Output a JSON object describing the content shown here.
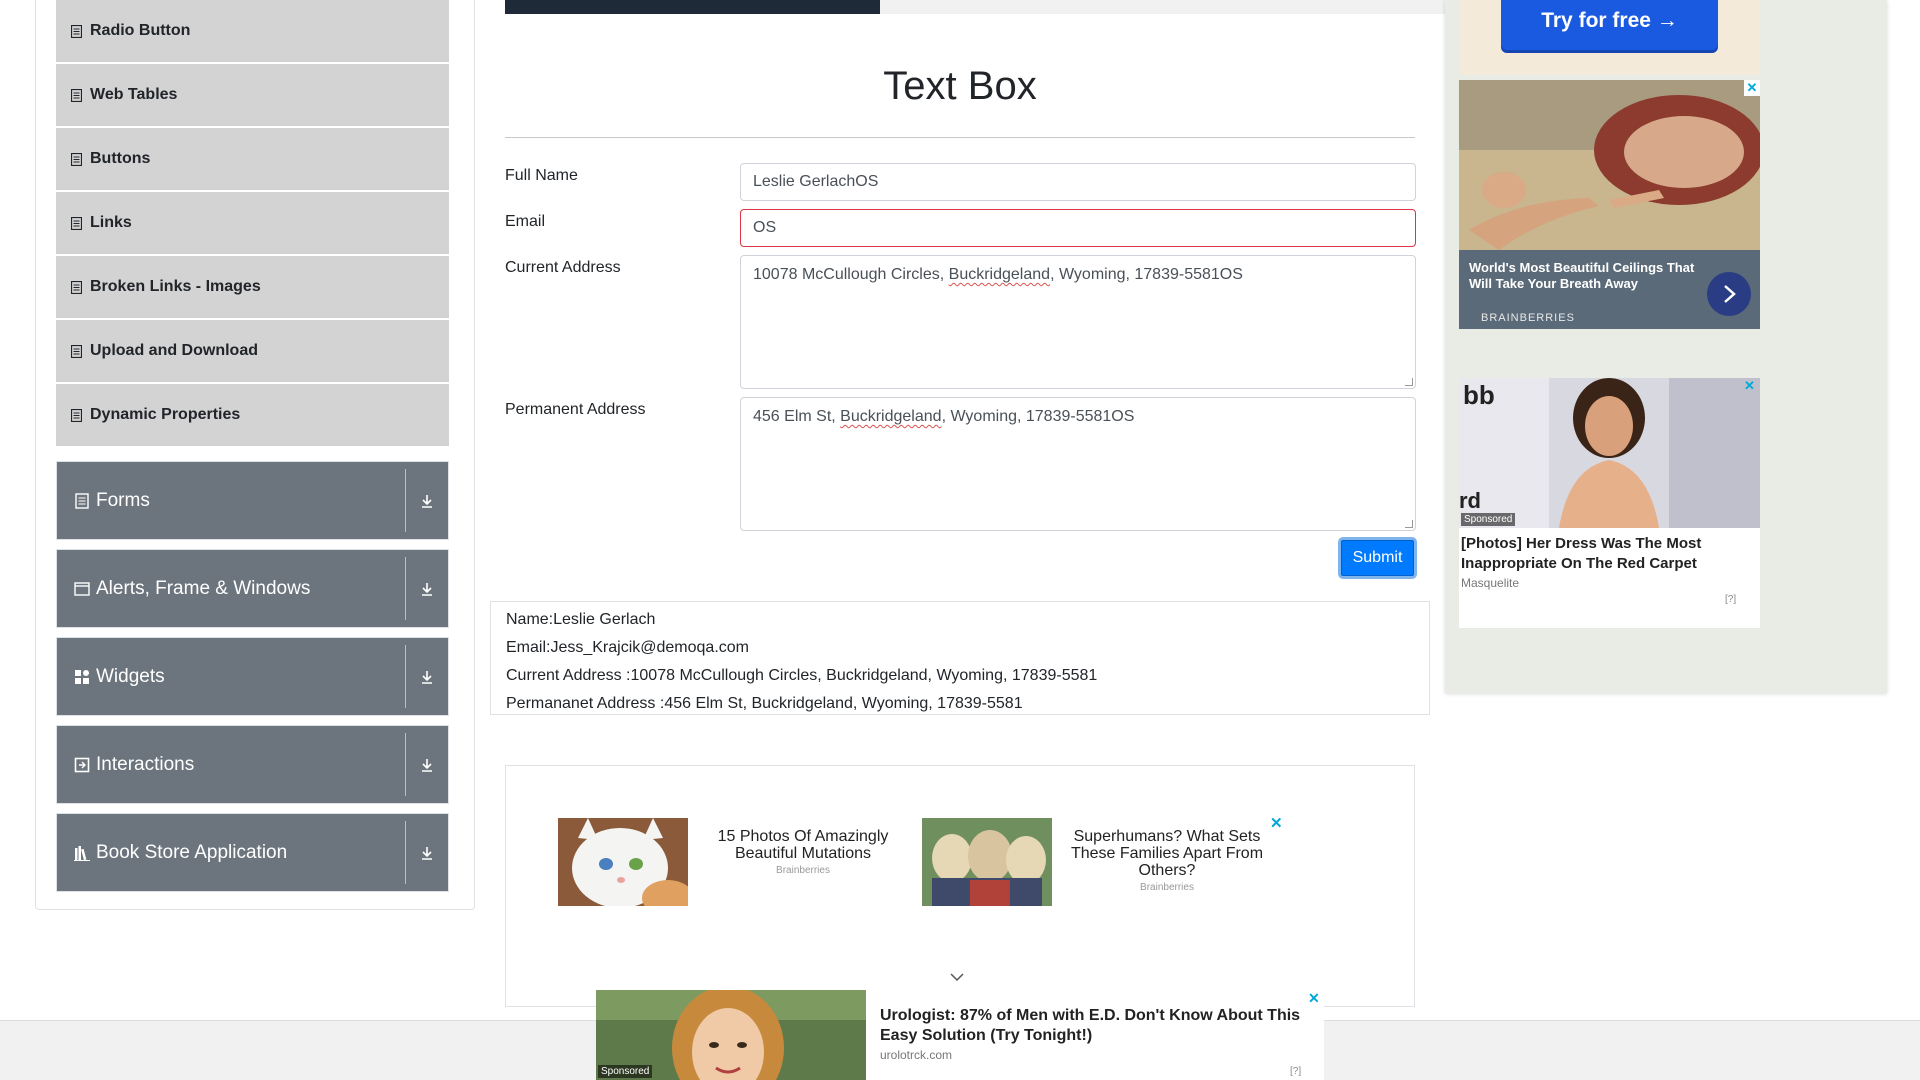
{
  "sidebar": {
    "menu_items": [
      {
        "label": "Radio Button"
      },
      {
        "label": "Web Tables"
      },
      {
        "label": "Buttons"
      },
      {
        "label": "Links"
      },
      {
        "label": "Broken Links - Images"
      },
      {
        "label": "Upload and Download"
      },
      {
        "label": "Dynamic Properties"
      }
    ],
    "groups": [
      {
        "label": "Forms",
        "icon": "form-icon"
      },
      {
        "label": "Alerts, Frame & Windows",
        "icon": "window-icon"
      },
      {
        "label": "Widgets",
        "icon": "widgets-icon"
      },
      {
        "label": "Interactions",
        "icon": "interactions-icon"
      },
      {
        "label": "Book Store Application",
        "icon": "bookstore-icon"
      }
    ]
  },
  "main": {
    "title": "Text Box",
    "form": {
      "full_name_label": "Full Name",
      "full_name_value": "Leslie GerlachOS",
      "email_label": "Email",
      "email_value": "OS",
      "current_address_label": "Current Address",
      "current_address_value": {
        "pre": "10078 McCullough Circles, ",
        "flagged": "Buckridgeland",
        "post": ", Wyoming, 17839-5581OS"
      },
      "permanent_address_label": "Permanent Address",
      "permanent_address_value": {
        "pre": "456 Elm St, ",
        "flagged": "Buckridgeland",
        "post": ", Wyoming, 17839-5581OS"
      },
      "submit_label": "Submit"
    },
    "output": {
      "name": "Name:Leslie Gerlach",
      "email": "Email:Jess_Krajcik@demoqa.com",
      "current_address": "Current Address :10078 McCullough Circles, Buckridgeland, Wyoming, 17839-5581",
      "permanent_address": "Permananet Address :456 Elm St, Buckridgeland, Wyoming, 17839-5581"
    }
  },
  "ads": {
    "try_button": "Try for free →",
    "ceiling": {
      "title": "World's Most Beautiful Ceilings That Will Take Your Breath Away",
      "source": "BRAINBERRIES"
    },
    "dress": {
      "title": "[Photos] Her Dress Was The Most Inappropriate On The Red Carpet",
      "source": "Masquelite",
      "sponsored": "Sponsored",
      "adchoice": "[?]"
    },
    "cards": [
      {
        "title": "15 Photos Of Amazingly Beautiful Mutations",
        "source": "Brainberries"
      },
      {
        "title": "Superhumans? What Sets These Families Apart From Others?",
        "source": "Brainberries"
      }
    ],
    "sticky": {
      "title": "Urologist: 87% of Men with E.D. Don't Know About This Easy Solution (Try Tonight!)",
      "source": "urolotrck.com",
      "sponsored": "Sponsored",
      "adchoice": "[?]"
    },
    "close_glyph": "✕"
  },
  "colors": {
    "sidebar_group": "#6c757d",
    "sidebar_item": "#d3d3d3",
    "primary": "#007bff",
    "error": "#dc3545"
  }
}
